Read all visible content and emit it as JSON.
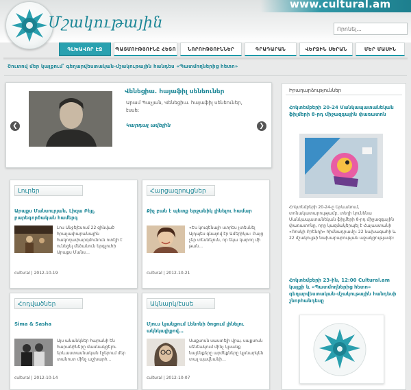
{
  "header": {
    "site_url": "www.cultural.am",
    "logo_text": "Մշակութային",
    "search_placeholder": "Որոնել..."
  },
  "nav": {
    "items": [
      {
        "label": "ԳԼԽԱՎՈՐ ԷՋ",
        "active": true
      },
      {
        "label": "ՊԱՏՄՈՒԹՅՈՒՆԸ ՀԵՏՈ",
        "active": false
      },
      {
        "label": "ՆՈՐՈՒԹՅՈՒՆՆԵՐ",
        "active": false
      },
      {
        "label": "ԳՐԱԴԱՐԱՆ",
        "active": false
      },
      {
        "label": "ՎԵՐՋԻՆ ՍԵՐԱՆ",
        "active": false
      },
      {
        "label": "ՄԵՐ ՄԱՍԻՆ",
        "active": false
      }
    ]
  },
  "announcement": "Շուտով մեր կայքում՝ գեղարվեստական-մշակութային հանդես «Պատմողներից հետո»",
  "slider": {
    "title": "Վենեցիա. հայաֆիլ սենեուներ",
    "description": "Արամ Պաչյան, Վենեցիա. հայաֆիլ սենեուներ, էսսե:",
    "more_label": "Կարդալ ավելին",
    "prev_arrow": "❮",
    "next_arrow": "❯"
  },
  "cards": [
    {
      "tab": "Լուրեր",
      "title": "Արաքս Մանսուրյան, Լիզա Բեյլ. բարեգործական համերգ",
      "text": "Լոս Անջելեսում 22 զինված հրաչափարանային հակողափարգմունուն ոտէյի է ունեցել մեծանուն երգչուհի Արաքս Մանս…",
      "meta": "cultural | 2012-10-19"
    },
    {
      "tab": "Հարցազրույցներ",
      "title": "Քիչ բան է պետք երջանիկ լինելու համար",
      "text": "«Ես կուզենայի ստրես չտեսնել Այդպես գնալով էր Ամերիկա: Բայց չեր տեսնելուն, որ եկա կարող մի թան…",
      "meta": "cultural | 2012-10-21"
    },
    {
      "tab": "Հոդվածներ",
      "title": "Sima & Sasha",
      "text": "Այս անանկներ հարանի են հարանիները մասնակցելու երևաստասնական էջերում մեր տանուտ մինչ աշխարհ…",
      "meta": "cultural | 2012-10-14"
    },
    {
      "tab": "Ակնարկ/էսսե",
      "title": "Մյուս կյանքում Լենոնի ծոցում լինելու ակնկալիքով…",
      "text": "Սաքսոսն սաստելի վրա, սաքսոսն սենեակում մինչ կլսանք նայենքերը արժեքները կլսնարկեն տալ պավնանի…",
      "meta": "cultural | 2012-10-07"
    }
  ],
  "sidebar": {
    "heading": "Իրադարձություններ",
    "event1_title": "Հոկտեմբերի 20-24 Մանկապատանեկան ֆիլմերի 8-րդ միջազգային փառատոն",
    "event1_text": "Հոկտեմբերի 20-24-ը Երևանում, տոնակատարությամբ, տեղի կունենա Մանկապատանեկան ֆիլմերի 8-րդ միջազգային փառատոնը, որը կազմակերպել է Հայաստանի «Ռոսկի Բրենդի» հիմնադրամը: 22 նախագահի և 22 մշակույթի նախարարության աջակցությամբ:",
    "event2_title": "Հոկտեմբերի 23-ին, 12:00 Cultural.am կայքի և «Պատմողներից հետո» գեղարվեստական-մշակութային հանդեսի շնորհանդեսը"
  },
  "colors": {
    "accent": "#1e8797",
    "nav_active": "#2aa1b0"
  }
}
